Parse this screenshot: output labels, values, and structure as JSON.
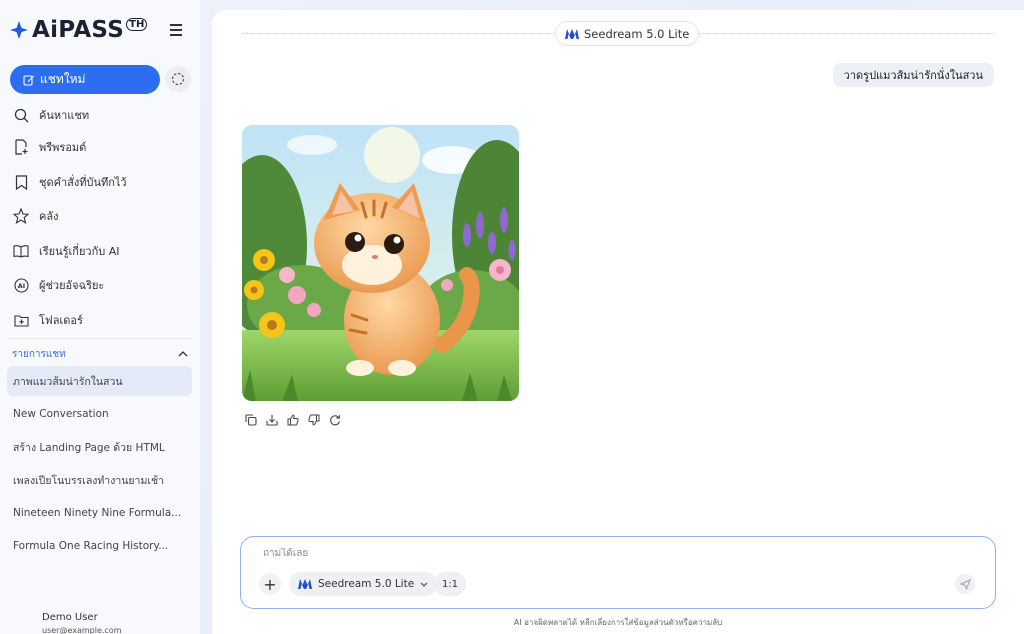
{
  "brand": {
    "name": "AiPASS",
    "mark": "TH"
  },
  "sidebar": {
    "new_chat_label": "แชทใหม่",
    "menu": [
      {
        "label": "ค้นหาแชท",
        "icon": "search-icon"
      },
      {
        "label": "พรีพรอมต์",
        "icon": "document-plus-icon"
      },
      {
        "label": "ชุดคำสั่งที่บันทึกไว้",
        "icon": "bookmark-icon"
      },
      {
        "label": "คลัง",
        "icon": "star-icon"
      },
      {
        "label": "เรียนรู้เกี่ยวกับ AI",
        "icon": "book-icon"
      },
      {
        "label": "ผู้ช่วยอัจฉริยะ",
        "icon": "ai-badge-icon"
      },
      {
        "label": "โฟลเดอร์",
        "icon": "folder-icon"
      }
    ],
    "section_title": "รายการแชท",
    "chats": [
      "ภาพแมวส้มน่ารักในสวน",
      "New Conversation",
      "สร้าง Landing Page ด้วย HTML",
      "เพลงเปียโนบรรเลงทำงานยามเช้า",
      "Nineteen Ninety Nine Formula...",
      "Formula One Racing History..."
    ],
    "user": {
      "name": "Demo User",
      "email": "user@example.com"
    }
  },
  "main": {
    "model_name": "Seedream 5.0 Lite",
    "user_message": "วาดรูปแมวส้มน่ารักนั่งในสวน",
    "composer": {
      "placeholder": "ถามได้เลย",
      "model_select": "Seedream 5.0 Lite",
      "ratio": "1:1"
    },
    "disclaimer": "AI อาจผิดพลาดได้ หลีกเลี่ยงการใส่ข้อมูลส่วนตัวหรือความลับ"
  },
  "colors": {
    "accent": "#2d6ef0",
    "section": "#3a6ee8",
    "model_logo": "#1f4fd6"
  }
}
